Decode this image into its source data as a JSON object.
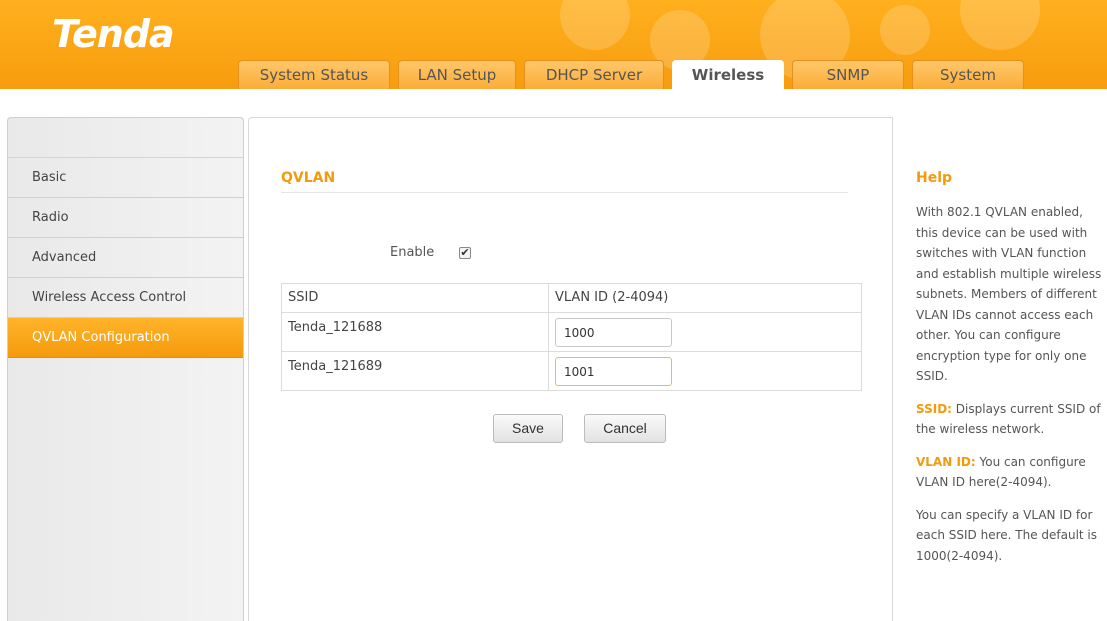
{
  "brand": {
    "logo": "Tenda"
  },
  "tabs": [
    {
      "label": "System Status",
      "active": false
    },
    {
      "label": "LAN Setup",
      "active": false
    },
    {
      "label": "DHCP Server",
      "active": false
    },
    {
      "label": "Wireless",
      "active": true
    },
    {
      "label": "SNMP",
      "active": false
    },
    {
      "label": "System",
      "active": false
    }
  ],
  "sidebar": {
    "items": [
      {
        "label": "Basic",
        "active": false
      },
      {
        "label": "Radio",
        "active": false
      },
      {
        "label": "Advanced",
        "active": false
      },
      {
        "label": "Wireless Access Control",
        "active": false
      },
      {
        "label": "QVLAN Configuration",
        "active": true
      }
    ]
  },
  "main": {
    "title": "QVLAN",
    "enable_label": "Enable",
    "enable_checked": true,
    "checkmark": "✔",
    "table": {
      "headers": [
        "SSID",
        "VLAN ID (2-4094)"
      ],
      "rows": [
        {
          "ssid": "Tenda_121688",
          "vlan": "1000"
        },
        {
          "ssid": "Tenda_121689",
          "vlan": "1001"
        }
      ]
    },
    "save_label": "Save",
    "cancel_label": "Cancel"
  },
  "help": {
    "title": "Help",
    "intro": "With 802.1 QVLAN enabled, this device can be used with switches with VLAN function and establish multiple wireless subnets. Members of different VLAN IDs cannot access each other. You can configure encryption type for only one SSID.",
    "ssid_key": "SSID:",
    "ssid_text": " Displays current SSID of the wireless network.",
    "vlan_key": "VLAN ID:",
    "vlan_text": " You can configure VLAN ID here(2-4094).",
    "note": "You can specify a VLAN ID for each SSID here. The default is 1000(2-4094)."
  },
  "colors": {
    "accent": "#f39a0d",
    "header": "#ffa81a"
  }
}
